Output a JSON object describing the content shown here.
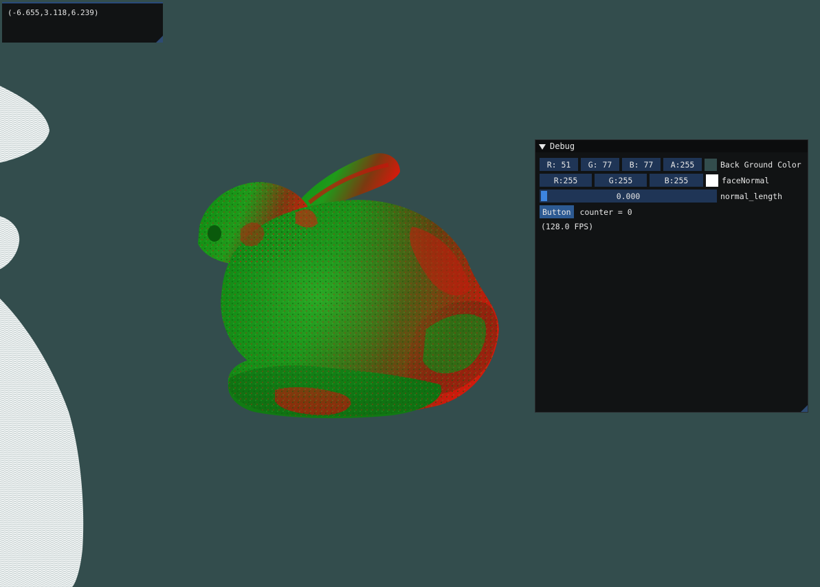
{
  "camera_position": "(-6.655,3.118,6.239)",
  "colors": {
    "background": "#334d4d",
    "face_normal": "#ffffff",
    "window_bg": "#111314",
    "field_bg": "#1f3556",
    "accent": "#3d85e0",
    "button": "#2d5a92"
  },
  "debug": {
    "title": "Debug",
    "bg_color": {
      "r": "R: 51",
      "g": "G: 77",
      "b": "B: 77",
      "a": "A:255",
      "label": "Back Ground Color"
    },
    "face_normal": {
      "r": "R:255",
      "g": "G:255",
      "b": "B:255",
      "label": "faceNormal"
    },
    "normal_length": {
      "value": "0.000",
      "label": "normal_length"
    },
    "button_label": "Button",
    "counter_text": "counter = 0",
    "fps_text": "(128.0 FPS)"
  }
}
